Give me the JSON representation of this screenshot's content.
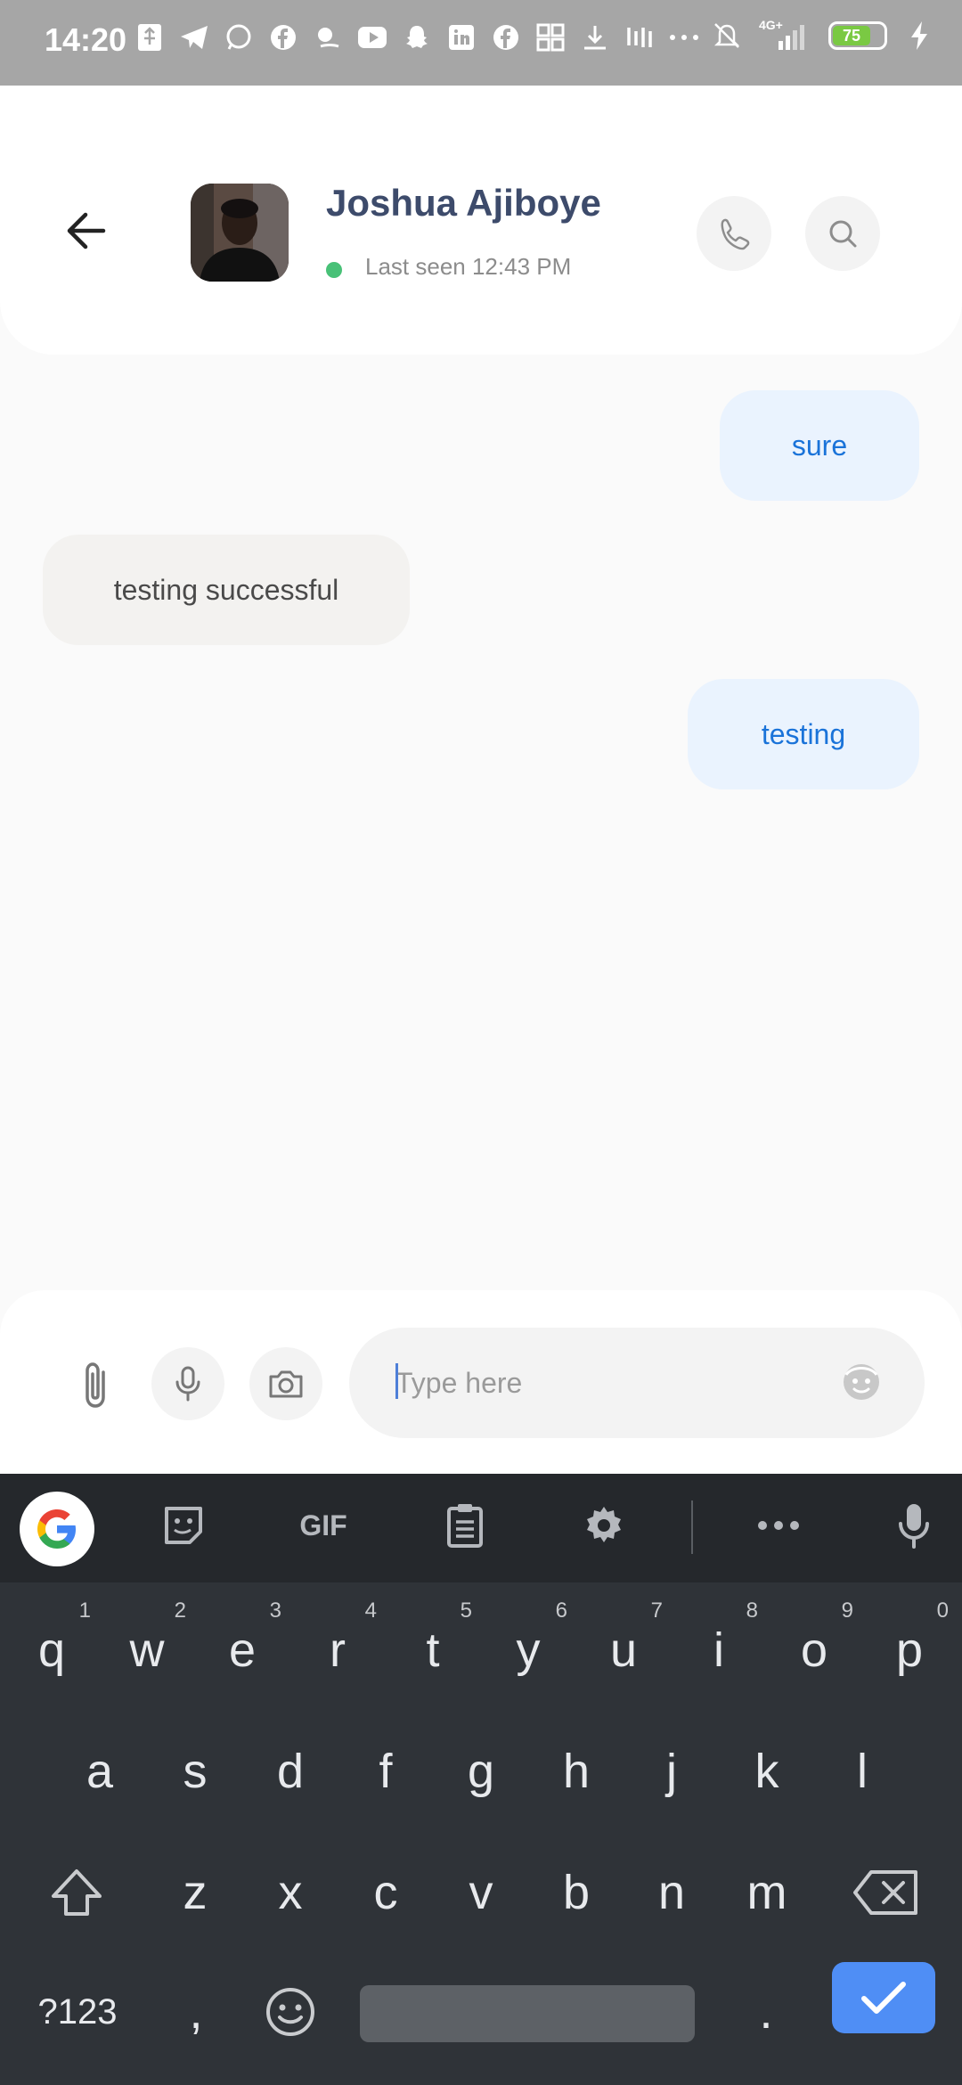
{
  "status_bar": {
    "time": "14:20",
    "network": "4G+",
    "battery": "75",
    "battery_level_percent": 75,
    "notification_icons": [
      "usb-icon",
      "telegram-icon",
      "whatsapp-icon",
      "facebook-icon",
      "bird-icon",
      "youtube-icon",
      "snapchat-icon",
      "linkedin-icon",
      "facebook-icon",
      "grid-icon",
      "download-icon",
      "jiji-icon",
      "more-icon"
    ]
  },
  "header": {
    "contact_name": "Joshua Ajiboye",
    "last_seen": "Last seen 12:43 PM",
    "online_color": "#48c177"
  },
  "messages": [
    {
      "text": "sure",
      "direction": "outgoing"
    },
    {
      "text": "testing successful",
      "direction": "incoming"
    },
    {
      "text": "testing",
      "direction": "outgoing"
    }
  ],
  "composer": {
    "placeholder": "Type here",
    "value": ""
  },
  "keyboard": {
    "toolbar": {
      "gif_label": "GIF"
    },
    "row1": [
      {
        "key": "q",
        "hint": "1"
      },
      {
        "key": "w",
        "hint": "2"
      },
      {
        "key": "e",
        "hint": "3"
      },
      {
        "key": "r",
        "hint": "4"
      },
      {
        "key": "t",
        "hint": "5"
      },
      {
        "key": "y",
        "hint": "6"
      },
      {
        "key": "u",
        "hint": "7"
      },
      {
        "key": "i",
        "hint": "8"
      },
      {
        "key": "o",
        "hint": "9"
      },
      {
        "key": "p",
        "hint": "0"
      }
    ],
    "row2": [
      "a",
      "s",
      "d",
      "f",
      "g",
      "h",
      "j",
      "k",
      "l"
    ],
    "row3": [
      "z",
      "x",
      "c",
      "v",
      "b",
      "n",
      "m"
    ],
    "sym_label": "?123",
    "comma": ",",
    "period": ".",
    "accent_color": "#4f8ef5"
  }
}
